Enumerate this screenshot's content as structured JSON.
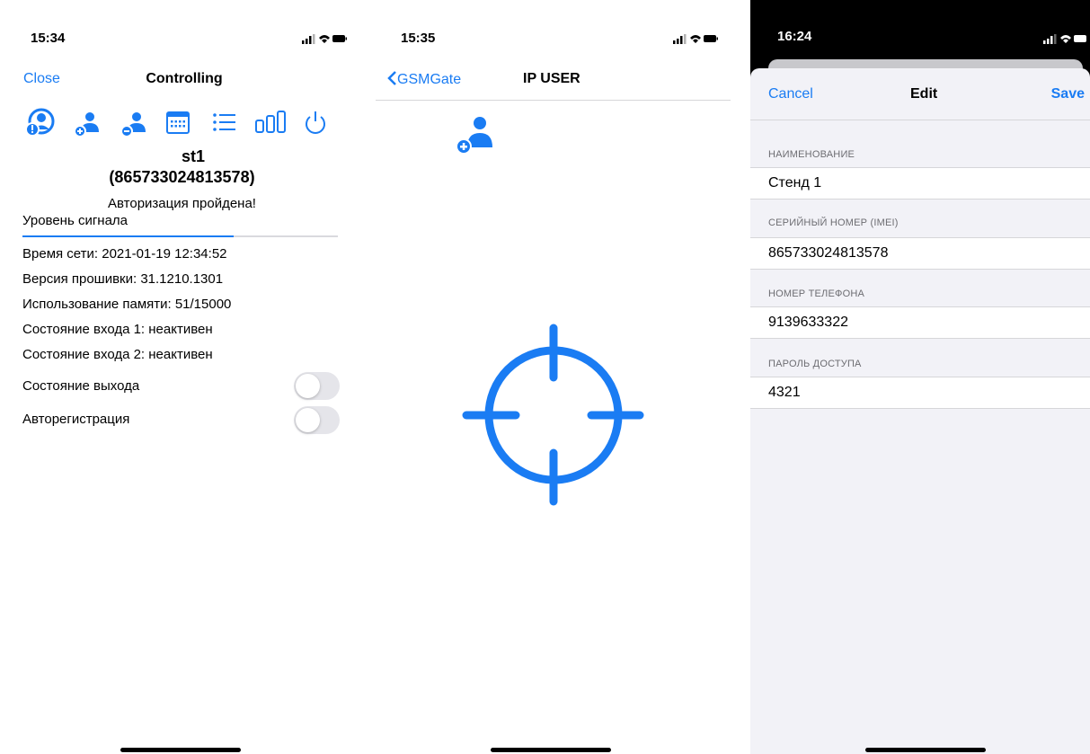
{
  "colors": {
    "accent": "#1a7cf3",
    "toggle_off": "#e5e5ea",
    "grouped_bg": "#f2f2f7"
  },
  "screen1": {
    "status_time": "15:34",
    "nav": {
      "close": "Close",
      "title": "Controlling"
    },
    "toolbar_icons": [
      "user-info-icon",
      "add-user-icon",
      "remove-user-icon",
      "calendar-icon",
      "list-icon",
      "bar-chart-icon",
      "power-icon"
    ],
    "device_name": "st1",
    "device_imei": "(865733024813578)",
    "auth_status": "Авторизация пройдена!",
    "signal_label": "Уровень сигнала",
    "signal_level": 0.67,
    "info": {
      "network_time": "Время сети: 2021-01-19 12:34:52",
      "firmware": "Версия прошивки: 31.1210.1301",
      "memory": "Использование памяти: 51/15000",
      "input1": "Состояние входа 1: неактивен",
      "input2": "Состояние входа 2: неактивен"
    },
    "output_label": "Состояние выхода",
    "output_on": false,
    "autoreg_label": "Авторегистрация",
    "autoreg_on": false
  },
  "screen2": {
    "status_time": "15:35",
    "nav": {
      "back": "GSMGate",
      "title": "IP USER"
    },
    "icons": [
      "add-user-icon",
      "crosshair-icon"
    ]
  },
  "screen3": {
    "status_time": "16:24",
    "nav": {
      "cancel": "Cancel",
      "title": "Edit",
      "save": "Save"
    },
    "fields": [
      {
        "label": "НАИМЕНОВАНИЕ",
        "value": "Стенд 1"
      },
      {
        "label": "СЕРИЙНЫЙ НОМЕР (IMEI)",
        "value": "865733024813578"
      },
      {
        "label": "НОМЕР ТЕЛЕФОНА",
        "value": "9139633322"
      },
      {
        "label": "ПАРОЛЬ ДОСТУПА",
        "value": "4321"
      }
    ]
  }
}
